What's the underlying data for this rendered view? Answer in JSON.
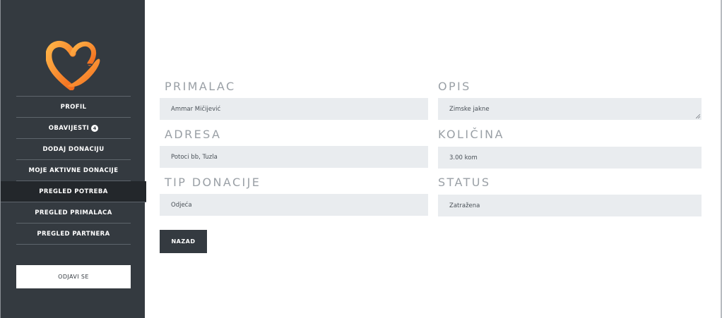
{
  "sidebar": {
    "items": [
      {
        "label": "PROFIL"
      },
      {
        "label": "OBAVIJESTI",
        "badge": "4"
      },
      {
        "label": "DODAJ DONACIJU"
      },
      {
        "label": "MOJE AKTIVNE DONACIJE"
      },
      {
        "label": "PREGLED POTREBA",
        "active": true
      },
      {
        "label": "PREGLED PRIMALACA"
      },
      {
        "label": "PREGLED PARTNERA"
      }
    ],
    "logout_label": "ODJAVI SE"
  },
  "form": {
    "primalac": {
      "label": "PRIMALAC",
      "value": "Ammar Mičijević"
    },
    "opis": {
      "label": "OPIS",
      "value": "Zimske jakne"
    },
    "adresa": {
      "label": "ADRESA",
      "value": "Potoci bb, Tuzla"
    },
    "kolicina": {
      "label": "KOLIČINA",
      "value": "3.00 kom"
    },
    "tip_donacije": {
      "label": "TIP DONACIJE",
      "value": "Odjeća"
    },
    "status": {
      "label": "STATUS",
      "value": "Zatražena"
    }
  },
  "back_label": "NAZAD",
  "icons": {
    "logo": "heart-hand-logo",
    "resize": "resize-handle-icon"
  },
  "colors": {
    "sidebar": "#343a40",
    "active_item": "#23272b",
    "field_bg": "#e9ecef",
    "label": "#9aa0a6",
    "logo_orange": "#f7941d"
  }
}
